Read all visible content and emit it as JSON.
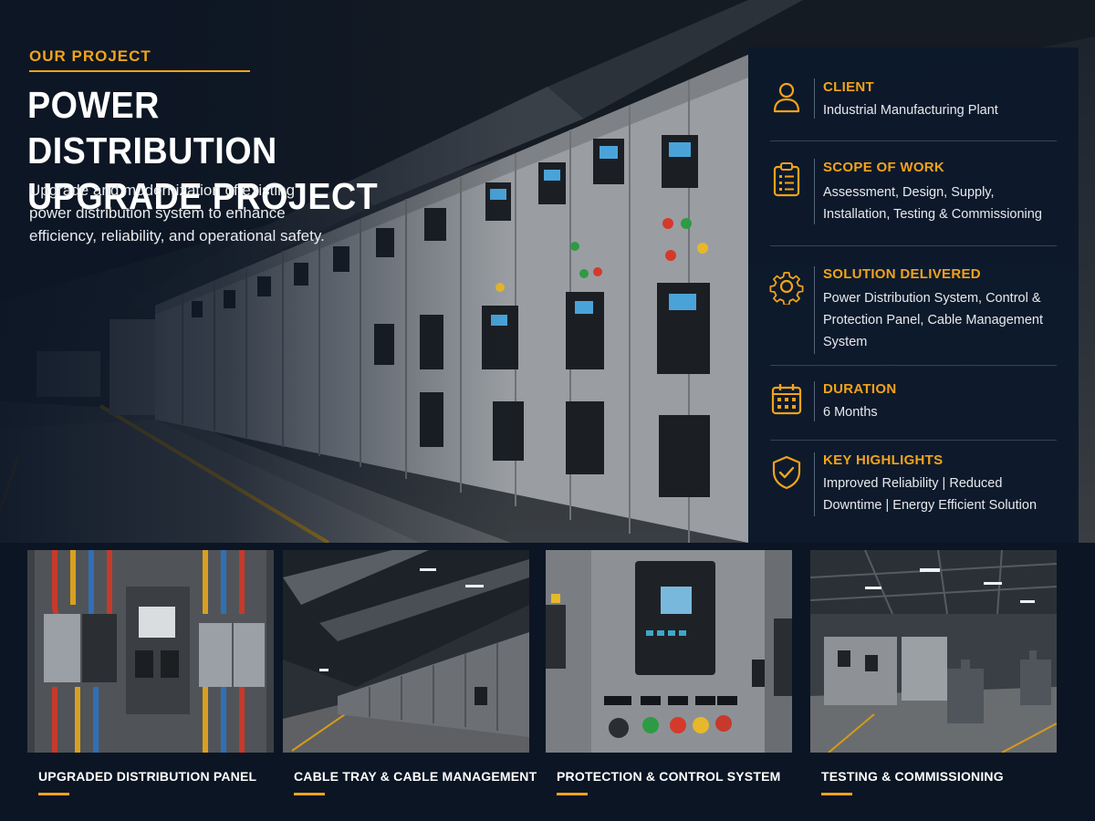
{
  "hero": {
    "eyebrow": "OUR PROJECT",
    "title_line1": "POWER DISTRIBUTION",
    "title_line2": "UPGRADE PROJECT",
    "description": "Upgrade and modernization of existing power distribution system to enhance efficiency, reliability, and operational safety."
  },
  "info": {
    "client": {
      "label": "CLIENT",
      "value": "Industrial Manufacturing Plant",
      "icon": "person-icon"
    },
    "scope": {
      "label": "SCOPE OF WORK",
      "value": "Assessment, Design, Supply, Installation, Testing & Commissioning",
      "icon": "clipboard-icon"
    },
    "solution": {
      "label": "SOLUTION DELIVERED",
      "value": "Power Distribution System, Control & Protection Panel, Cable Management System",
      "icon": "gear-icon"
    },
    "duration": {
      "label": "DURATION",
      "value": "6 Months",
      "icon": "calendar-icon"
    },
    "highlights": {
      "label": "KEY HIGHLIGHTS",
      "value": "Improved Reliability | Reduced Downtime | Energy Efficient Solution",
      "icon": "shield-check-icon"
    }
  },
  "gallery": [
    {
      "caption": "UPGRADED DISTRIBUTION PANEL"
    },
    {
      "caption": "CABLE TRAY & CABLE MANAGEMENT"
    },
    {
      "caption": "PROTECTION & CONTROL SYSTEM"
    },
    {
      "caption": "TESTING & COMMISSIONING"
    }
  ],
  "colors": {
    "accent": "#f2a31b",
    "background": "#0b1524",
    "panel": "#0c192b",
    "text": "#ffffff"
  }
}
